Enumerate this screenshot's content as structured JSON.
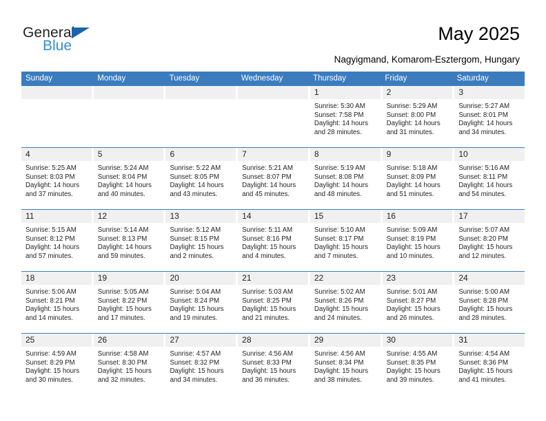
{
  "brand": {
    "name_top": "General",
    "name_bottom": "Blue",
    "triangle_color": "#1b63ad",
    "blue_text_color": "#2f8ed6"
  },
  "header": {
    "title": "May 2025",
    "subtitle": "Nagyigmand, Komarom-Esztergom, Hungary"
  },
  "theme": {
    "header_blue": "#3b7cbe",
    "daynum_band": "#f0f0f0",
    "page_background": "#ffffff",
    "text": "#231f20"
  },
  "calendar": {
    "weekday_headers": [
      "Sunday",
      "Monday",
      "Tuesday",
      "Wednesday",
      "Thursday",
      "Friday",
      "Saturday"
    ],
    "weeks": [
      [
        {
          "day": "",
          "sunrise": "",
          "sunset": "",
          "daylight_line1": "",
          "daylight_line2": ""
        },
        {
          "day": "",
          "sunrise": "",
          "sunset": "",
          "daylight_line1": "",
          "daylight_line2": ""
        },
        {
          "day": "",
          "sunrise": "",
          "sunset": "",
          "daylight_line1": "",
          "daylight_line2": ""
        },
        {
          "day": "",
          "sunrise": "",
          "sunset": "",
          "daylight_line1": "",
          "daylight_line2": ""
        },
        {
          "day": "1",
          "sunrise": "Sunrise: 5:30 AM",
          "sunset": "Sunset: 7:58 PM",
          "daylight_line1": "Daylight: 14 hours",
          "daylight_line2": "and 28 minutes."
        },
        {
          "day": "2",
          "sunrise": "Sunrise: 5:29 AM",
          "sunset": "Sunset: 8:00 PM",
          "daylight_line1": "Daylight: 14 hours",
          "daylight_line2": "and 31 minutes."
        },
        {
          "day": "3",
          "sunrise": "Sunrise: 5:27 AM",
          "sunset": "Sunset: 8:01 PM",
          "daylight_line1": "Daylight: 14 hours",
          "daylight_line2": "and 34 minutes."
        }
      ],
      [
        {
          "day": "4",
          "sunrise": "Sunrise: 5:25 AM",
          "sunset": "Sunset: 8:03 PM",
          "daylight_line1": "Daylight: 14 hours",
          "daylight_line2": "and 37 minutes."
        },
        {
          "day": "5",
          "sunrise": "Sunrise: 5:24 AM",
          "sunset": "Sunset: 8:04 PM",
          "daylight_line1": "Daylight: 14 hours",
          "daylight_line2": "and 40 minutes."
        },
        {
          "day": "6",
          "sunrise": "Sunrise: 5:22 AM",
          "sunset": "Sunset: 8:05 PM",
          "daylight_line1": "Daylight: 14 hours",
          "daylight_line2": "and 43 minutes."
        },
        {
          "day": "7",
          "sunrise": "Sunrise: 5:21 AM",
          "sunset": "Sunset: 8:07 PM",
          "daylight_line1": "Daylight: 14 hours",
          "daylight_line2": "and 45 minutes."
        },
        {
          "day": "8",
          "sunrise": "Sunrise: 5:19 AM",
          "sunset": "Sunset: 8:08 PM",
          "daylight_line1": "Daylight: 14 hours",
          "daylight_line2": "and 48 minutes."
        },
        {
          "day": "9",
          "sunrise": "Sunrise: 5:18 AM",
          "sunset": "Sunset: 8:09 PM",
          "daylight_line1": "Daylight: 14 hours",
          "daylight_line2": "and 51 minutes."
        },
        {
          "day": "10",
          "sunrise": "Sunrise: 5:16 AM",
          "sunset": "Sunset: 8:11 PM",
          "daylight_line1": "Daylight: 14 hours",
          "daylight_line2": "and 54 minutes."
        }
      ],
      [
        {
          "day": "11",
          "sunrise": "Sunrise: 5:15 AM",
          "sunset": "Sunset: 8:12 PM",
          "daylight_line1": "Daylight: 14 hours",
          "daylight_line2": "and 57 minutes."
        },
        {
          "day": "12",
          "sunrise": "Sunrise: 5:14 AM",
          "sunset": "Sunset: 8:13 PM",
          "daylight_line1": "Daylight: 14 hours",
          "daylight_line2": "and 59 minutes."
        },
        {
          "day": "13",
          "sunrise": "Sunrise: 5:12 AM",
          "sunset": "Sunset: 8:15 PM",
          "daylight_line1": "Daylight: 15 hours",
          "daylight_line2": "and 2 minutes."
        },
        {
          "day": "14",
          "sunrise": "Sunrise: 5:11 AM",
          "sunset": "Sunset: 8:16 PM",
          "daylight_line1": "Daylight: 15 hours",
          "daylight_line2": "and 4 minutes."
        },
        {
          "day": "15",
          "sunrise": "Sunrise: 5:10 AM",
          "sunset": "Sunset: 8:17 PM",
          "daylight_line1": "Daylight: 15 hours",
          "daylight_line2": "and 7 minutes."
        },
        {
          "day": "16",
          "sunrise": "Sunrise: 5:09 AM",
          "sunset": "Sunset: 8:19 PM",
          "daylight_line1": "Daylight: 15 hours",
          "daylight_line2": "and 10 minutes."
        },
        {
          "day": "17",
          "sunrise": "Sunrise: 5:07 AM",
          "sunset": "Sunset: 8:20 PM",
          "daylight_line1": "Daylight: 15 hours",
          "daylight_line2": "and 12 minutes."
        }
      ],
      [
        {
          "day": "18",
          "sunrise": "Sunrise: 5:06 AM",
          "sunset": "Sunset: 8:21 PM",
          "daylight_line1": "Daylight: 15 hours",
          "daylight_line2": "and 14 minutes."
        },
        {
          "day": "19",
          "sunrise": "Sunrise: 5:05 AM",
          "sunset": "Sunset: 8:22 PM",
          "daylight_line1": "Daylight: 15 hours",
          "daylight_line2": "and 17 minutes."
        },
        {
          "day": "20",
          "sunrise": "Sunrise: 5:04 AM",
          "sunset": "Sunset: 8:24 PM",
          "daylight_line1": "Daylight: 15 hours",
          "daylight_line2": "and 19 minutes."
        },
        {
          "day": "21",
          "sunrise": "Sunrise: 5:03 AM",
          "sunset": "Sunset: 8:25 PM",
          "daylight_line1": "Daylight: 15 hours",
          "daylight_line2": "and 21 minutes."
        },
        {
          "day": "22",
          "sunrise": "Sunrise: 5:02 AM",
          "sunset": "Sunset: 8:26 PM",
          "daylight_line1": "Daylight: 15 hours",
          "daylight_line2": "and 24 minutes."
        },
        {
          "day": "23",
          "sunrise": "Sunrise: 5:01 AM",
          "sunset": "Sunset: 8:27 PM",
          "daylight_line1": "Daylight: 15 hours",
          "daylight_line2": "and 26 minutes."
        },
        {
          "day": "24",
          "sunrise": "Sunrise: 5:00 AM",
          "sunset": "Sunset: 8:28 PM",
          "daylight_line1": "Daylight: 15 hours",
          "daylight_line2": "and 28 minutes."
        }
      ],
      [
        {
          "day": "25",
          "sunrise": "Sunrise: 4:59 AM",
          "sunset": "Sunset: 8:29 PM",
          "daylight_line1": "Daylight: 15 hours",
          "daylight_line2": "and 30 minutes."
        },
        {
          "day": "26",
          "sunrise": "Sunrise: 4:58 AM",
          "sunset": "Sunset: 8:30 PM",
          "daylight_line1": "Daylight: 15 hours",
          "daylight_line2": "and 32 minutes."
        },
        {
          "day": "27",
          "sunrise": "Sunrise: 4:57 AM",
          "sunset": "Sunset: 8:32 PM",
          "daylight_line1": "Daylight: 15 hours",
          "daylight_line2": "and 34 minutes."
        },
        {
          "day": "28",
          "sunrise": "Sunrise: 4:56 AM",
          "sunset": "Sunset: 8:33 PM",
          "daylight_line1": "Daylight: 15 hours",
          "daylight_line2": "and 36 minutes."
        },
        {
          "day": "29",
          "sunrise": "Sunrise: 4:56 AM",
          "sunset": "Sunset: 8:34 PM",
          "daylight_line1": "Daylight: 15 hours",
          "daylight_line2": "and 38 minutes."
        },
        {
          "day": "30",
          "sunrise": "Sunrise: 4:55 AM",
          "sunset": "Sunset: 8:35 PM",
          "daylight_line1": "Daylight: 15 hours",
          "daylight_line2": "and 39 minutes."
        },
        {
          "day": "31",
          "sunrise": "Sunrise: 4:54 AM",
          "sunset": "Sunset: 8:36 PM",
          "daylight_line1": "Daylight: 15 hours",
          "daylight_line2": "and 41 minutes."
        }
      ]
    ]
  }
}
